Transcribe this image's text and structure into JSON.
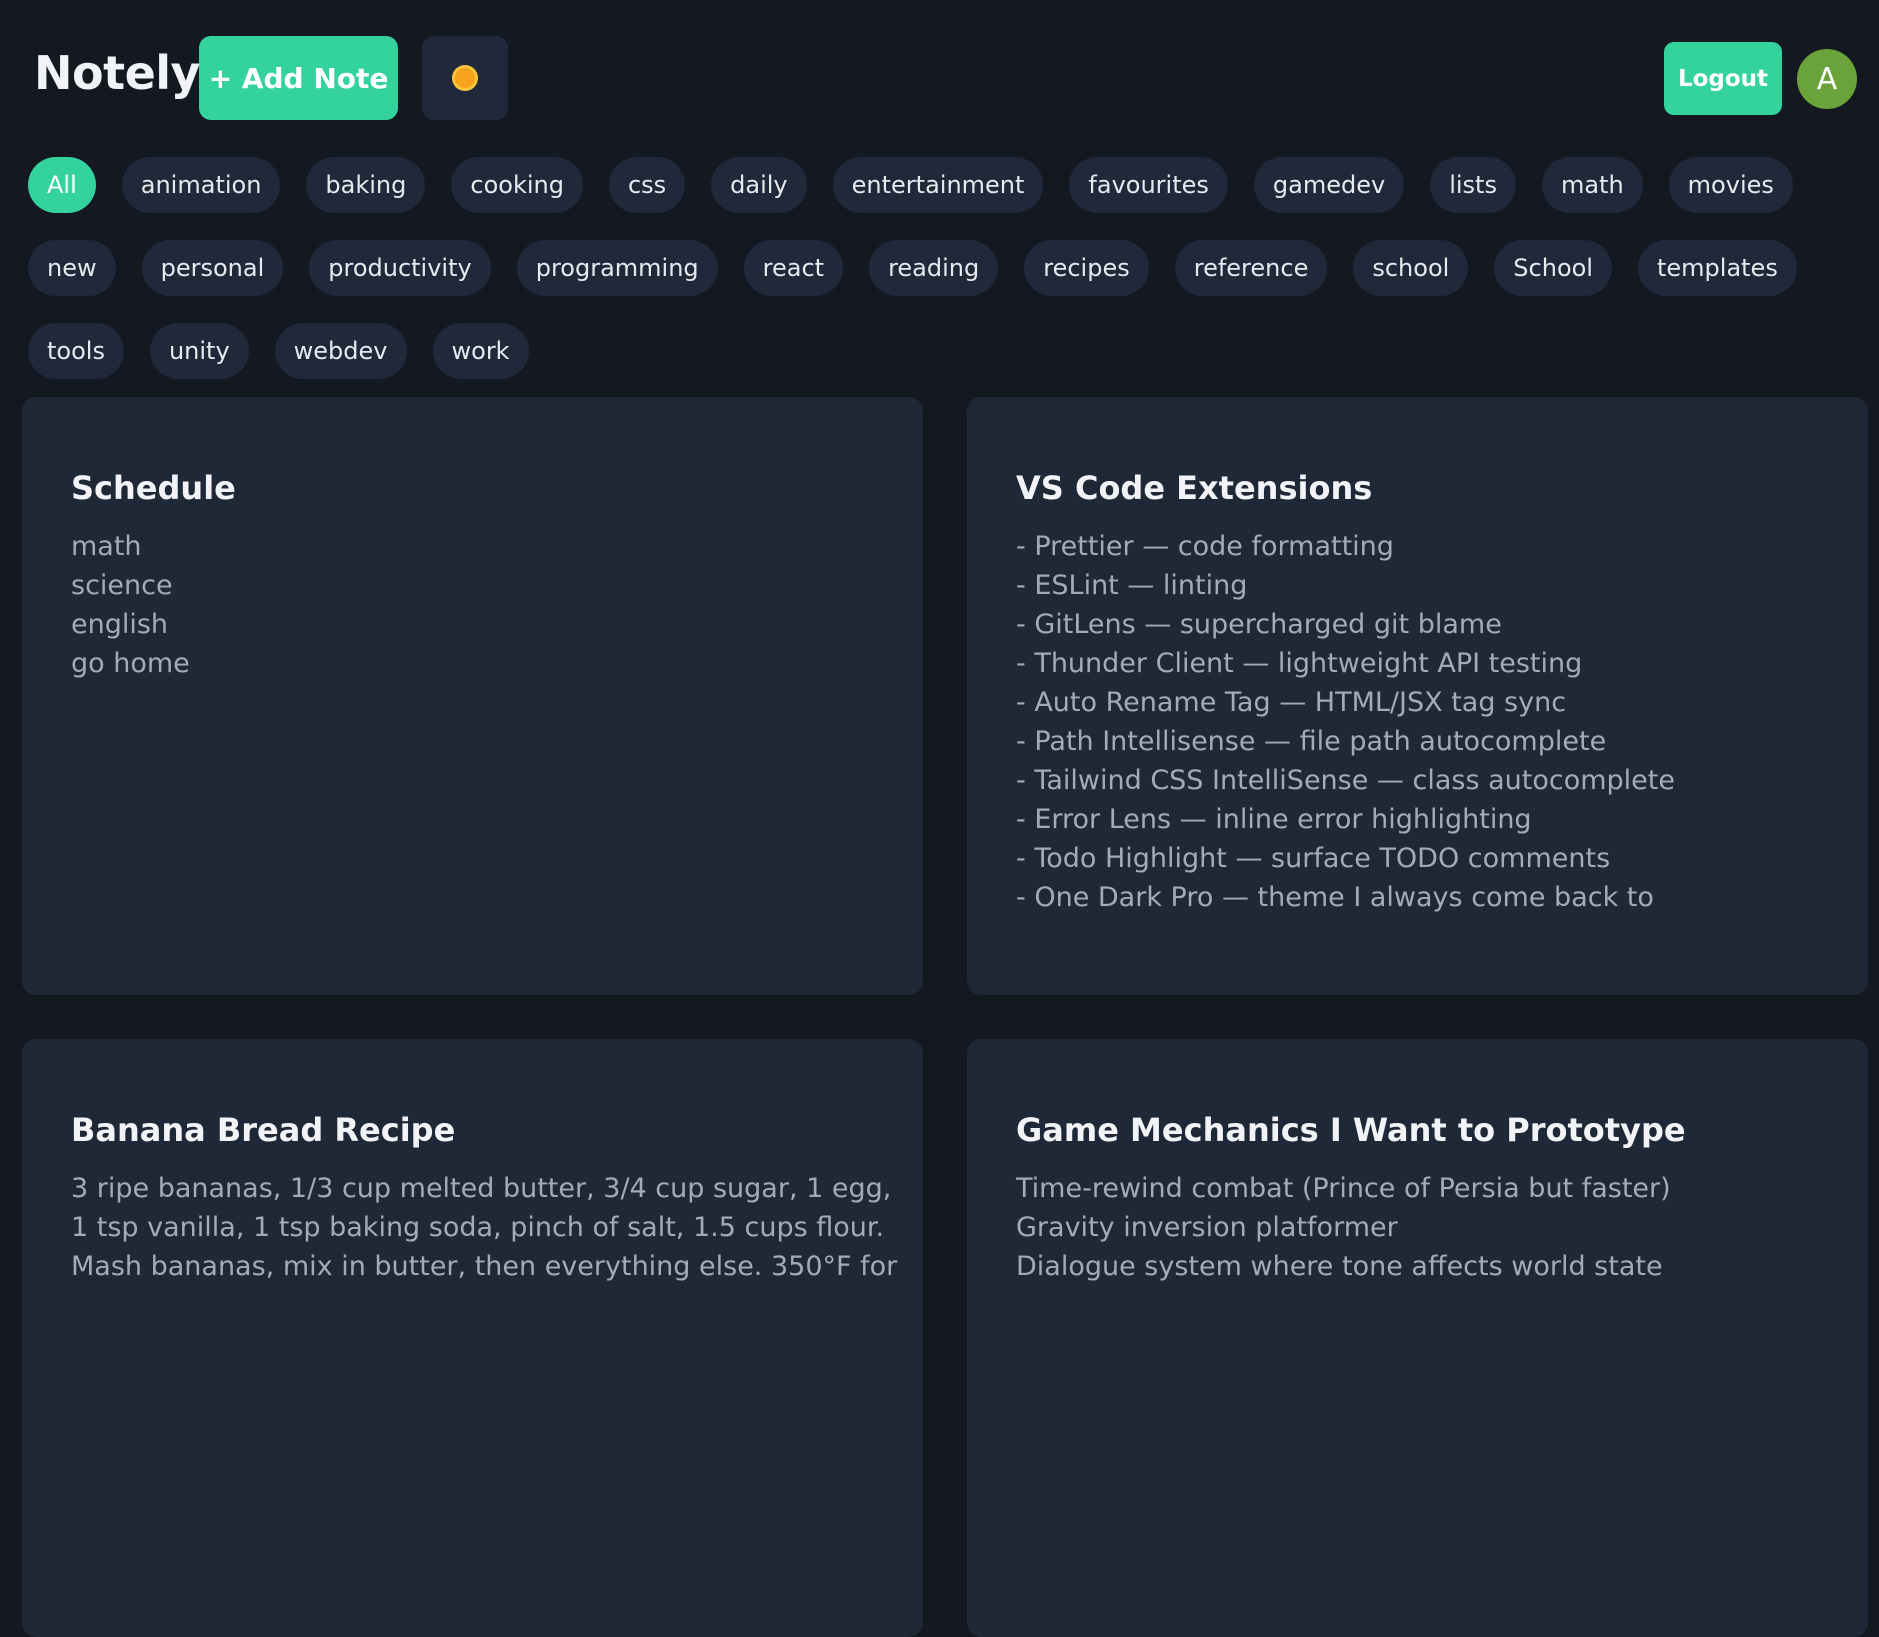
{
  "header": {
    "brand": "Notely",
    "add_note_label": "+ Add Note",
    "theme_toggle_icon": "sun-icon",
    "logout_label": "Logout",
    "avatar_initial": "A"
  },
  "tags": [
    {
      "label": "All",
      "active": true
    },
    {
      "label": "animation"
    },
    {
      "label": "baking"
    },
    {
      "label": "cooking"
    },
    {
      "label": "css"
    },
    {
      "label": "daily"
    },
    {
      "label": "entertainment"
    },
    {
      "label": "favourites"
    },
    {
      "label": "gamedev"
    },
    {
      "label": "lists"
    },
    {
      "label": "math"
    },
    {
      "label": "movies"
    },
    {
      "label": "new"
    },
    {
      "label": "personal"
    },
    {
      "label": "productivity"
    },
    {
      "label": "programming"
    },
    {
      "label": "react"
    },
    {
      "label": "reading"
    },
    {
      "label": "recipes"
    },
    {
      "label": "reference"
    },
    {
      "label": "school"
    },
    {
      "label": "School"
    },
    {
      "label": "templates"
    },
    {
      "label": "tools"
    },
    {
      "label": "unity"
    },
    {
      "label": "webdev"
    },
    {
      "label": "work"
    }
  ],
  "notes": [
    {
      "title": "Schedule",
      "lines": [
        "math",
        "science",
        "english",
        "go home"
      ]
    },
    {
      "title": "VS Code Extensions",
      "lines": [
        "- Prettier — code formatting",
        "- ESLint — linting",
        "- GitLens — supercharged git blame",
        "- Thunder Client — lightweight API testing",
        "- Auto Rename Tag — HTML/JSX tag sync",
        "- Path Intellisense — file path autocomplete",
        "- Tailwind CSS IntelliSense — class autocomplete",
        "- Error Lens — inline error highlighting",
        "- Todo Highlight — surface TODO comments",
        "- One Dark Pro — theme I always come back to"
      ]
    },
    {
      "title": "Banana Bread Recipe",
      "lines": [
        "3 ripe bananas, 1/3 cup melted butter, 3/4 cup sugar, 1 egg,",
        "1 tsp vanilla, 1 tsp baking soda, pinch of salt, 1.5 cups flour.",
        "Mash bananas, mix in butter, then everything else. 350°F for"
      ]
    },
    {
      "title": "Game Mechanics I Want to Prototype",
      "lines": [
        "Time-rewind combat (Prince of Persia but faster)",
        "Gravity inversion platformer",
        "Dialogue system where tone affects world state"
      ]
    }
  ]
}
